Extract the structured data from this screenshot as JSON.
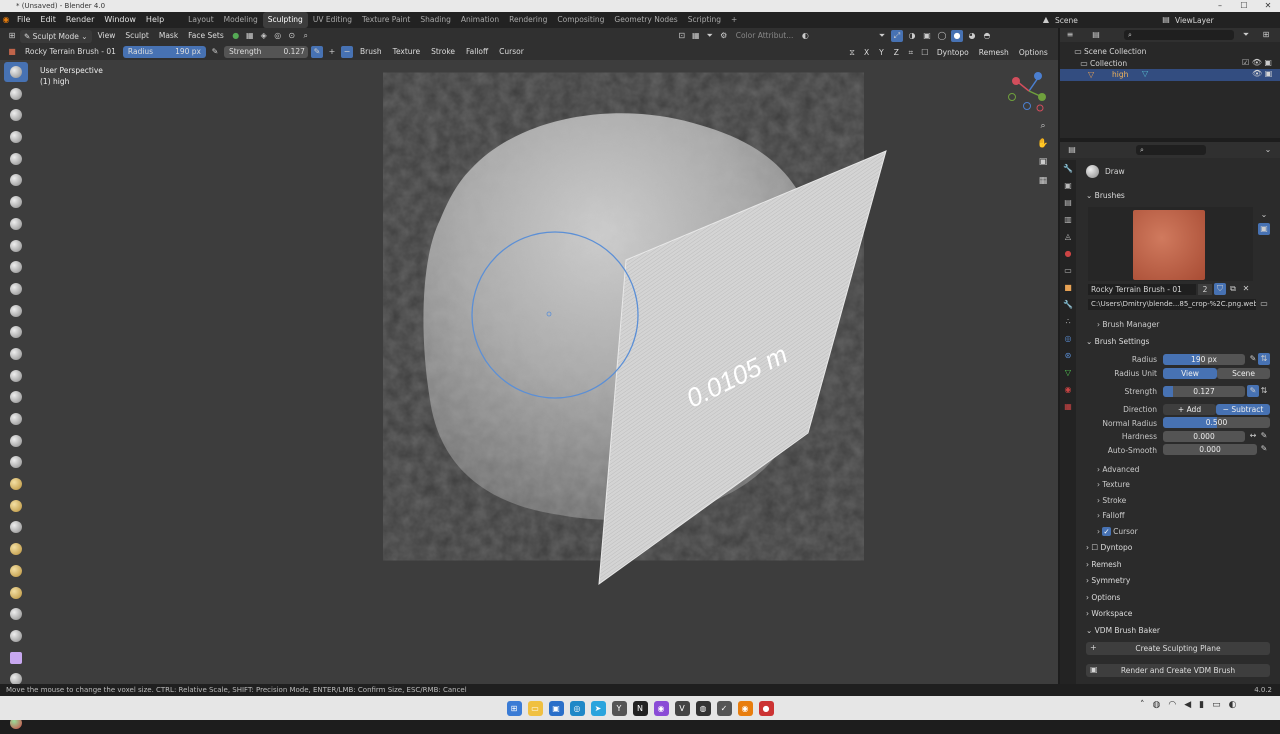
{
  "window": {
    "title": "* (Unsaved) - Blender 4.0"
  },
  "menu": [
    "File",
    "Edit",
    "Render",
    "Window",
    "Help"
  ],
  "workspaces": [
    {
      "label": "Layout",
      "active": false
    },
    {
      "label": "Modeling",
      "active": false
    },
    {
      "label": "Sculpting",
      "active": true
    },
    {
      "label": "UV Editing",
      "active": false
    },
    {
      "label": "Texture Paint",
      "active": false
    },
    {
      "label": "Shading",
      "active": false
    },
    {
      "label": "Animation",
      "active": false
    },
    {
      "label": "Rendering",
      "active": false
    },
    {
      "label": "Compositing",
      "active": false
    },
    {
      "label": "Geometry Nodes",
      "active": false
    },
    {
      "label": "Scripting",
      "active": false
    }
  ],
  "scene": {
    "name": "Scene",
    "view_layer": "ViewLayer"
  },
  "header1": {
    "mode": "Sculpt Mode",
    "menus": [
      "View",
      "Sculpt",
      "Mask",
      "Face Sets"
    ],
    "color_attribute": "Color Attribut..."
  },
  "header2": {
    "brush_name": "Rocky Terrain Brush - 01",
    "radius_label": "Radius",
    "radius_value": "190 px",
    "strength_label": "Strength",
    "strength_value": "0.127",
    "dropdowns": [
      "Brush",
      "Texture",
      "Stroke",
      "Falloff",
      "Cursor"
    ],
    "axes": [
      "X",
      "Y",
      "Z"
    ],
    "dyntopo": "Dyntopo",
    "remesh": "Remesh",
    "options": "Options"
  },
  "viewport": {
    "perspective": "User Perspective",
    "object": "(1) high",
    "overlay_text": "0.0105 m"
  },
  "outliner": {
    "root": "Scene Collection",
    "collection": "Collection",
    "object": "high"
  },
  "properties": {
    "tool_name": "Draw",
    "brushes_panel": "Brushes",
    "brush_name": "Rocky Terrain Brush - 01",
    "brush_users": "2",
    "texture_path": "C:\\Users\\Dmitry\\blende...85_crop-%2C.png.webp",
    "brush_manager": "Brush Manager",
    "brush_settings": "Brush Settings",
    "radius": {
      "label": "Radius",
      "value": "190 px",
      "fill": 0.45
    },
    "radius_unit": {
      "label": "Radius Unit",
      "options": [
        "View",
        "Scene"
      ],
      "selected": "View"
    },
    "strength": {
      "label": "Strength",
      "value": "0.127",
      "fill": 0.127
    },
    "direction": {
      "label": "Direction",
      "options": [
        "Add",
        "Subtract"
      ],
      "selected": "Subtract"
    },
    "normal_radius": {
      "label": "Normal Radius",
      "value": "0.500",
      "fill": 0.5
    },
    "hardness": {
      "label": "Hardness",
      "value": "0.000"
    },
    "auto_smooth": {
      "label": "Auto-Smooth",
      "value": "0.000"
    },
    "subpanels": [
      "Advanced",
      "Texture",
      "Stroke",
      "Falloff",
      "Cursor"
    ],
    "panels": [
      "Dyntopo",
      "Remesh",
      "Symmetry",
      "Options",
      "Workspace",
      "VDM Brush Baker"
    ],
    "create_plane": "Create Sculpting Plane",
    "render_vdm": "Render and Create VDM Brush"
  },
  "statusbar": {
    "hint": "Move the mouse to change the voxel size. CTRL: Relative Scale, SHIFT: Precision Mode, ENTER/LMB: Confirm Size, ESC/RMB: Cancel",
    "version": "4.0.2"
  },
  "colors": {
    "accent": "#4772b3",
    "viewport_bg": "#3d3d3d",
    "texture": "#c0644a"
  }
}
